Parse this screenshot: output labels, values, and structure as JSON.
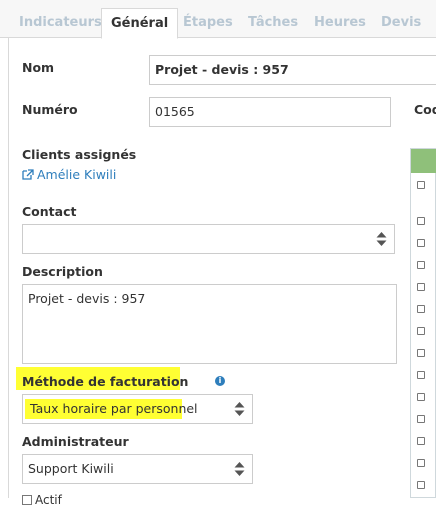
{
  "tabs": [
    {
      "label": "Indicateurs",
      "active": false
    },
    {
      "label": "Général",
      "active": true
    },
    {
      "label": "Étapes",
      "active": false
    },
    {
      "label": "Tâches",
      "active": false
    },
    {
      "label": "Heures",
      "active": false
    },
    {
      "label": "Devis",
      "active": false
    }
  ],
  "form": {
    "nom": {
      "label": "Nom",
      "value": "Projet - devis : 957"
    },
    "numero": {
      "label": "Numéro",
      "value": "01565"
    },
    "code_label_partial": "Cod",
    "clients": {
      "label": "Clients assignés",
      "link": "Amélie Kiwili"
    },
    "contact": {
      "label": "Contact",
      "value": ""
    },
    "description": {
      "label": "Description",
      "value": "Projet - devis : 957"
    },
    "billing": {
      "label": "Méthode de facturation",
      "value": "Taux horaire par personnel"
    },
    "admin": {
      "label": "Administrateur",
      "value": "Support Kiwili"
    },
    "actif_partial": "Actif"
  },
  "colors": {
    "highlight": "#ffff33",
    "link": "#2e7ebc",
    "inactive_tab": "#b8c7d3",
    "panel_header": "#8fc07a"
  },
  "icons": {
    "external_link": "external-link-icon",
    "info": "info-icon",
    "select_arrows": "sort-arrows-icon"
  }
}
